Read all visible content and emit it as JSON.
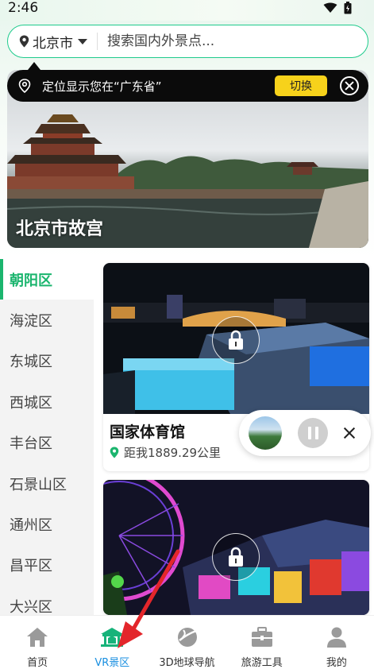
{
  "status_bar": {
    "time": "2:46"
  },
  "search": {
    "city": "北京市",
    "placeholder": "搜索国内外景点..."
  },
  "location_toast": {
    "text": "定位显示您在“广东省”",
    "switch_label": "切换"
  },
  "banner": {
    "title": "北京市故宫"
  },
  "districts": {
    "items": [
      {
        "label": "朝阳区",
        "active": true
      },
      {
        "label": "海淀区"
      },
      {
        "label": "东城区"
      },
      {
        "label": "西城区"
      },
      {
        "label": "丰台区"
      },
      {
        "label": "石景山区"
      },
      {
        "label": "通州区"
      },
      {
        "label": "昌平区"
      },
      {
        "label": "大兴区"
      }
    ]
  },
  "cards": [
    {
      "title": "国家体育馆",
      "distance": "距我1889.29公里",
      "locked": true
    },
    {
      "title": "",
      "distance": "",
      "locked": true
    }
  ],
  "audio_player": {
    "state": "paused"
  },
  "bottom_nav": {
    "items": [
      {
        "label": "首页",
        "icon": "home-icon"
      },
      {
        "label": "VR景区",
        "icon": "vr-scenic-icon",
        "active": true
      },
      {
        "label": "3D地球导航",
        "icon": "globe-nav-icon"
      },
      {
        "label": "旅游工具",
        "icon": "toolbox-icon"
      },
      {
        "label": "我的",
        "icon": "profile-icon"
      }
    ]
  },
  "colors": {
    "accent_green": "#1bb56e",
    "search_border": "#1ecb8c",
    "switch_yellow": "#f7d21b",
    "active_nav_blue": "#1a8fe0",
    "annotation_red": "#e3262b"
  }
}
